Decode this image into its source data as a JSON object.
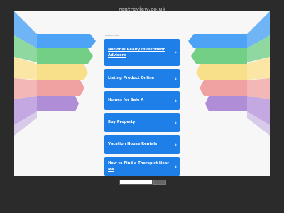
{
  "header": {
    "domain": "rentreview.co.uk"
  },
  "related_label": "Related Links",
  "links": [
    {
      "label": "National Realty Investment Advisors"
    },
    {
      "label": "Listing Product Online"
    },
    {
      "label": "Homes for Sale A"
    },
    {
      "label": "Buy Property"
    },
    {
      "label": "Vacation House Rentals"
    },
    {
      "label": "How to Find a Therapist Near Me"
    }
  ],
  "chevron": "›",
  "colors": {
    "button": "#1e7fe8",
    "background": "#2b2b2b",
    "panel": "#f7f7f7"
  },
  "ribbon_colors": [
    "#4fa3f7",
    "#72cf85",
    "#f8df8a",
    "#f0a1a2",
    "#b08ed7"
  ]
}
